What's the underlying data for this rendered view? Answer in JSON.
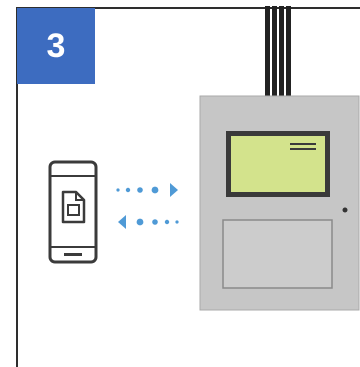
{
  "step": {
    "number": "3"
  },
  "colors": {
    "badge": "#3d6cc0",
    "frame": "#2e2e2e",
    "cable": "#222222",
    "panel_body": "#c6c6c6",
    "panel_border": "#a9a9a9",
    "screen_fill": "#d3e38c",
    "screen_bezel": "#3a3a3a",
    "arrow": "#4f9ad6",
    "phone": "#3b3b3b"
  },
  "icons": {
    "phone": "smartphone-icon",
    "file": "document-icon",
    "transfer": "bidirectional-arrows-icon"
  }
}
